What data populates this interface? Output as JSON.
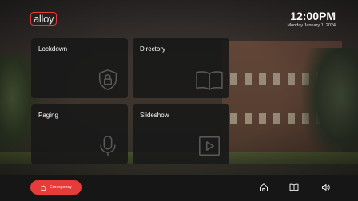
{
  "header": {
    "logo_text": "alloy",
    "time": "12:00PM",
    "date": "Monday January 1, 2024"
  },
  "tiles": [
    {
      "label": "Lockdown",
      "icon": "shield-lock-icon"
    },
    {
      "label": "Directory",
      "icon": "book-icon"
    },
    {
      "label": "Paging",
      "icon": "microphone-icon"
    },
    {
      "label": "Slideshow",
      "icon": "play-icon"
    }
  ],
  "bottom_bar": {
    "emergency_label": "Emergency",
    "emergency_icon": "alarm-icon",
    "nav": [
      {
        "name": "home",
        "icon": "home-icon"
      },
      {
        "name": "directory",
        "icon": "book-icon"
      },
      {
        "name": "paging",
        "icon": "speaker-icon"
      }
    ]
  },
  "colors": {
    "accent": "#e53b3b",
    "tile_background": "#181818",
    "text": "#ffffff",
    "icon": "#5a5a5a"
  }
}
